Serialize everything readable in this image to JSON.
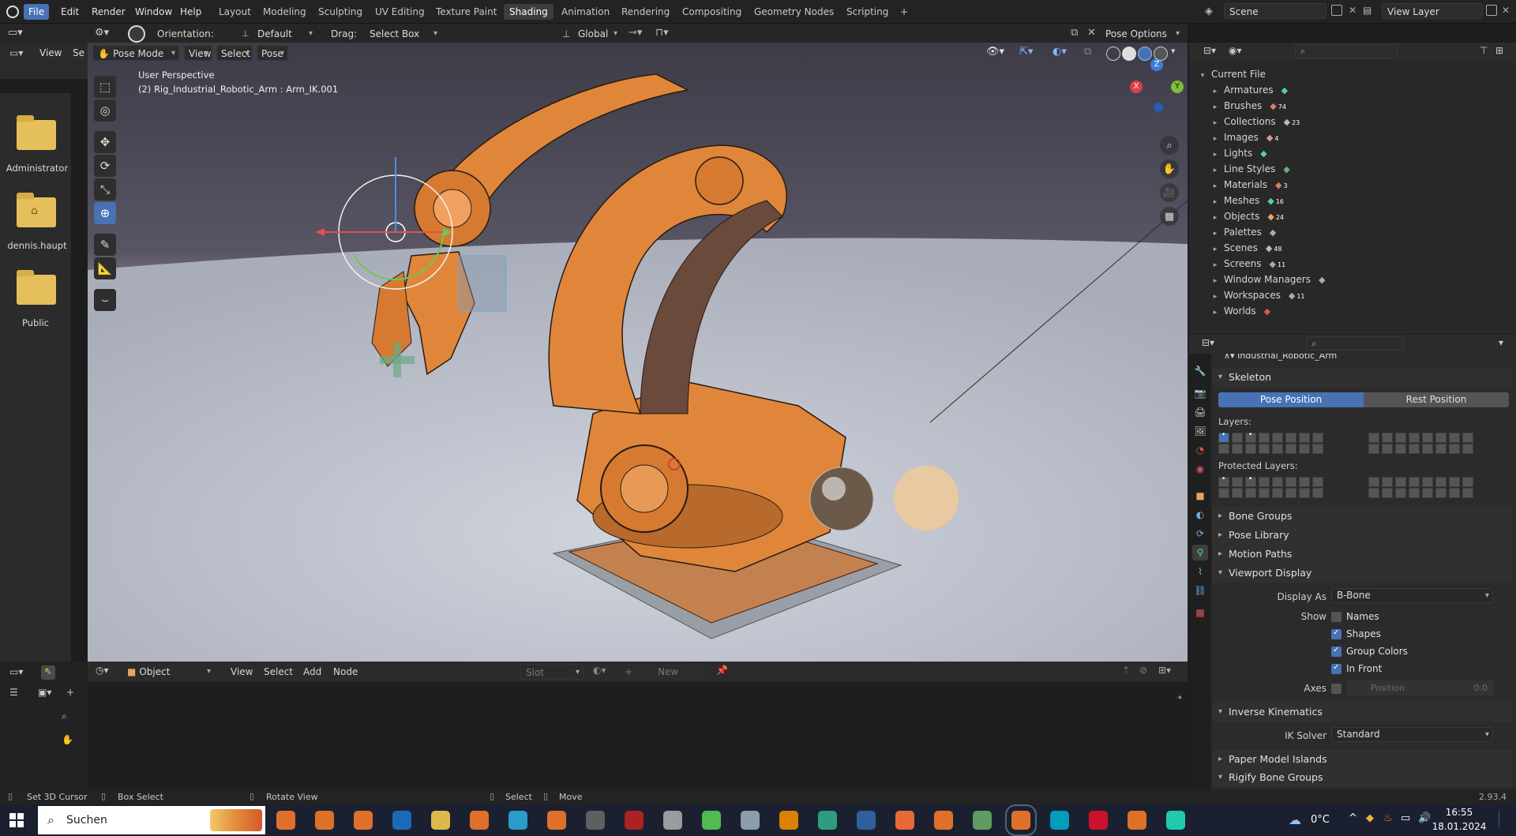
{
  "topbar": {
    "menus": [
      "File",
      "Edit",
      "Render",
      "Window",
      "Help"
    ],
    "workspaces": [
      "Layout",
      "Modeling",
      "Sculpting",
      "UV Editing",
      "Texture Paint",
      "Shading",
      "Animation",
      "Rendering",
      "Compositing",
      "Geometry Nodes",
      "Scripting"
    ],
    "active_workspace": "Shading",
    "add_symbol": "+",
    "scene_label": "Scene",
    "view_layer_label": "View Layer"
  },
  "toolheader": {
    "orientation_label": "Orientation:",
    "orientation_value": "Default",
    "drag_label": "Drag:",
    "drag_value": "Select Box",
    "transform_value": "Global",
    "pose_options": "Pose Options"
  },
  "file_browser": {
    "header": {
      "view": "View",
      "select_truncated": "Se"
    },
    "items": [
      {
        "name": "Administrator",
        "icon": "folder-icon"
      },
      {
        "name": "dennis.haupt",
        "icon": "home-folder-icon"
      },
      {
        "name": "Public",
        "icon": "folder-icon"
      }
    ]
  },
  "viewport": {
    "mode": "Pose Mode",
    "menus": [
      "View",
      "Select",
      "Pose"
    ],
    "overlay_title": "User Perspective",
    "overlay_object": "(2) Rig_Industrial_Robotic_Arm : Arm_IK.001",
    "gizmo_axes": {
      "z": "Z",
      "y": "Y",
      "x": "X"
    }
  },
  "node_editor": {
    "object_type": "Object",
    "menus": [
      "View",
      "Select",
      "Add",
      "Node"
    ],
    "slot": "Slot",
    "new_label": "New"
  },
  "outliner": {
    "root": "Current File",
    "items": [
      {
        "label": "Armatures",
        "count": ""
      },
      {
        "label": "Brushes",
        "count": "74"
      },
      {
        "label": "Collections",
        "count": "23"
      },
      {
        "label": "Images",
        "count": "4"
      },
      {
        "label": "Lights",
        "count": ""
      },
      {
        "label": "Line Styles",
        "count": ""
      },
      {
        "label": "Materials",
        "count": "3"
      },
      {
        "label": "Meshes",
        "count": "16"
      },
      {
        "label": "Objects",
        "count": "24"
      },
      {
        "label": "Palettes",
        "count": ""
      },
      {
        "label": "Scenes",
        "count": "48"
      },
      {
        "label": "Screens",
        "count": "11"
      },
      {
        "label": "Window Managers",
        "count": ""
      },
      {
        "label": "Workspaces",
        "count": "11"
      },
      {
        "label": "Worlds",
        "count": ""
      }
    ]
  },
  "properties": {
    "object_name": "Industrial_Robotic_Arm",
    "skeleton": "Skeleton",
    "pose_position": "Pose Position",
    "rest_position": "Rest Position",
    "layers_label": "Layers:",
    "protected_layers_label": "Protected Layers:",
    "panels_closed": [
      "Bone Groups",
      "Pose Library",
      "Motion Paths"
    ],
    "viewport_display": "Viewport Display",
    "display_as_label": "Display As",
    "display_as_value": "B-Bone",
    "show_label": "Show",
    "show_options": [
      {
        "label": "Names",
        "checked": false
      },
      {
        "label": "Shapes",
        "checked": true
      },
      {
        "label": "Group Colors",
        "checked": true
      },
      {
        "label": "In Front",
        "checked": true
      }
    ],
    "axes_label": "Axes",
    "axes_position_label": "Position",
    "axes_position_value": "0.0",
    "inverse_kinematics": "Inverse Kinematics",
    "ik_solver_label": "IK Solver",
    "ik_solver_value": "Standard",
    "paper_model_islands": "Paper Model Islands",
    "rigify_bone_groups": "Rigify Bone Groups"
  },
  "statusbar": {
    "hints": [
      "Set 3D Cursor",
      "Box Select",
      "Rotate View",
      "Select",
      "Move"
    ],
    "version": "2.93.4"
  },
  "taskbar": {
    "search": "Suchen",
    "temperature": "0°C",
    "time": "16:55",
    "date": "18.01.2024"
  },
  "colors": {
    "accent": "#4772b3",
    "robot_orange": "#e0863b",
    "folder": "#e5bf5b"
  }
}
